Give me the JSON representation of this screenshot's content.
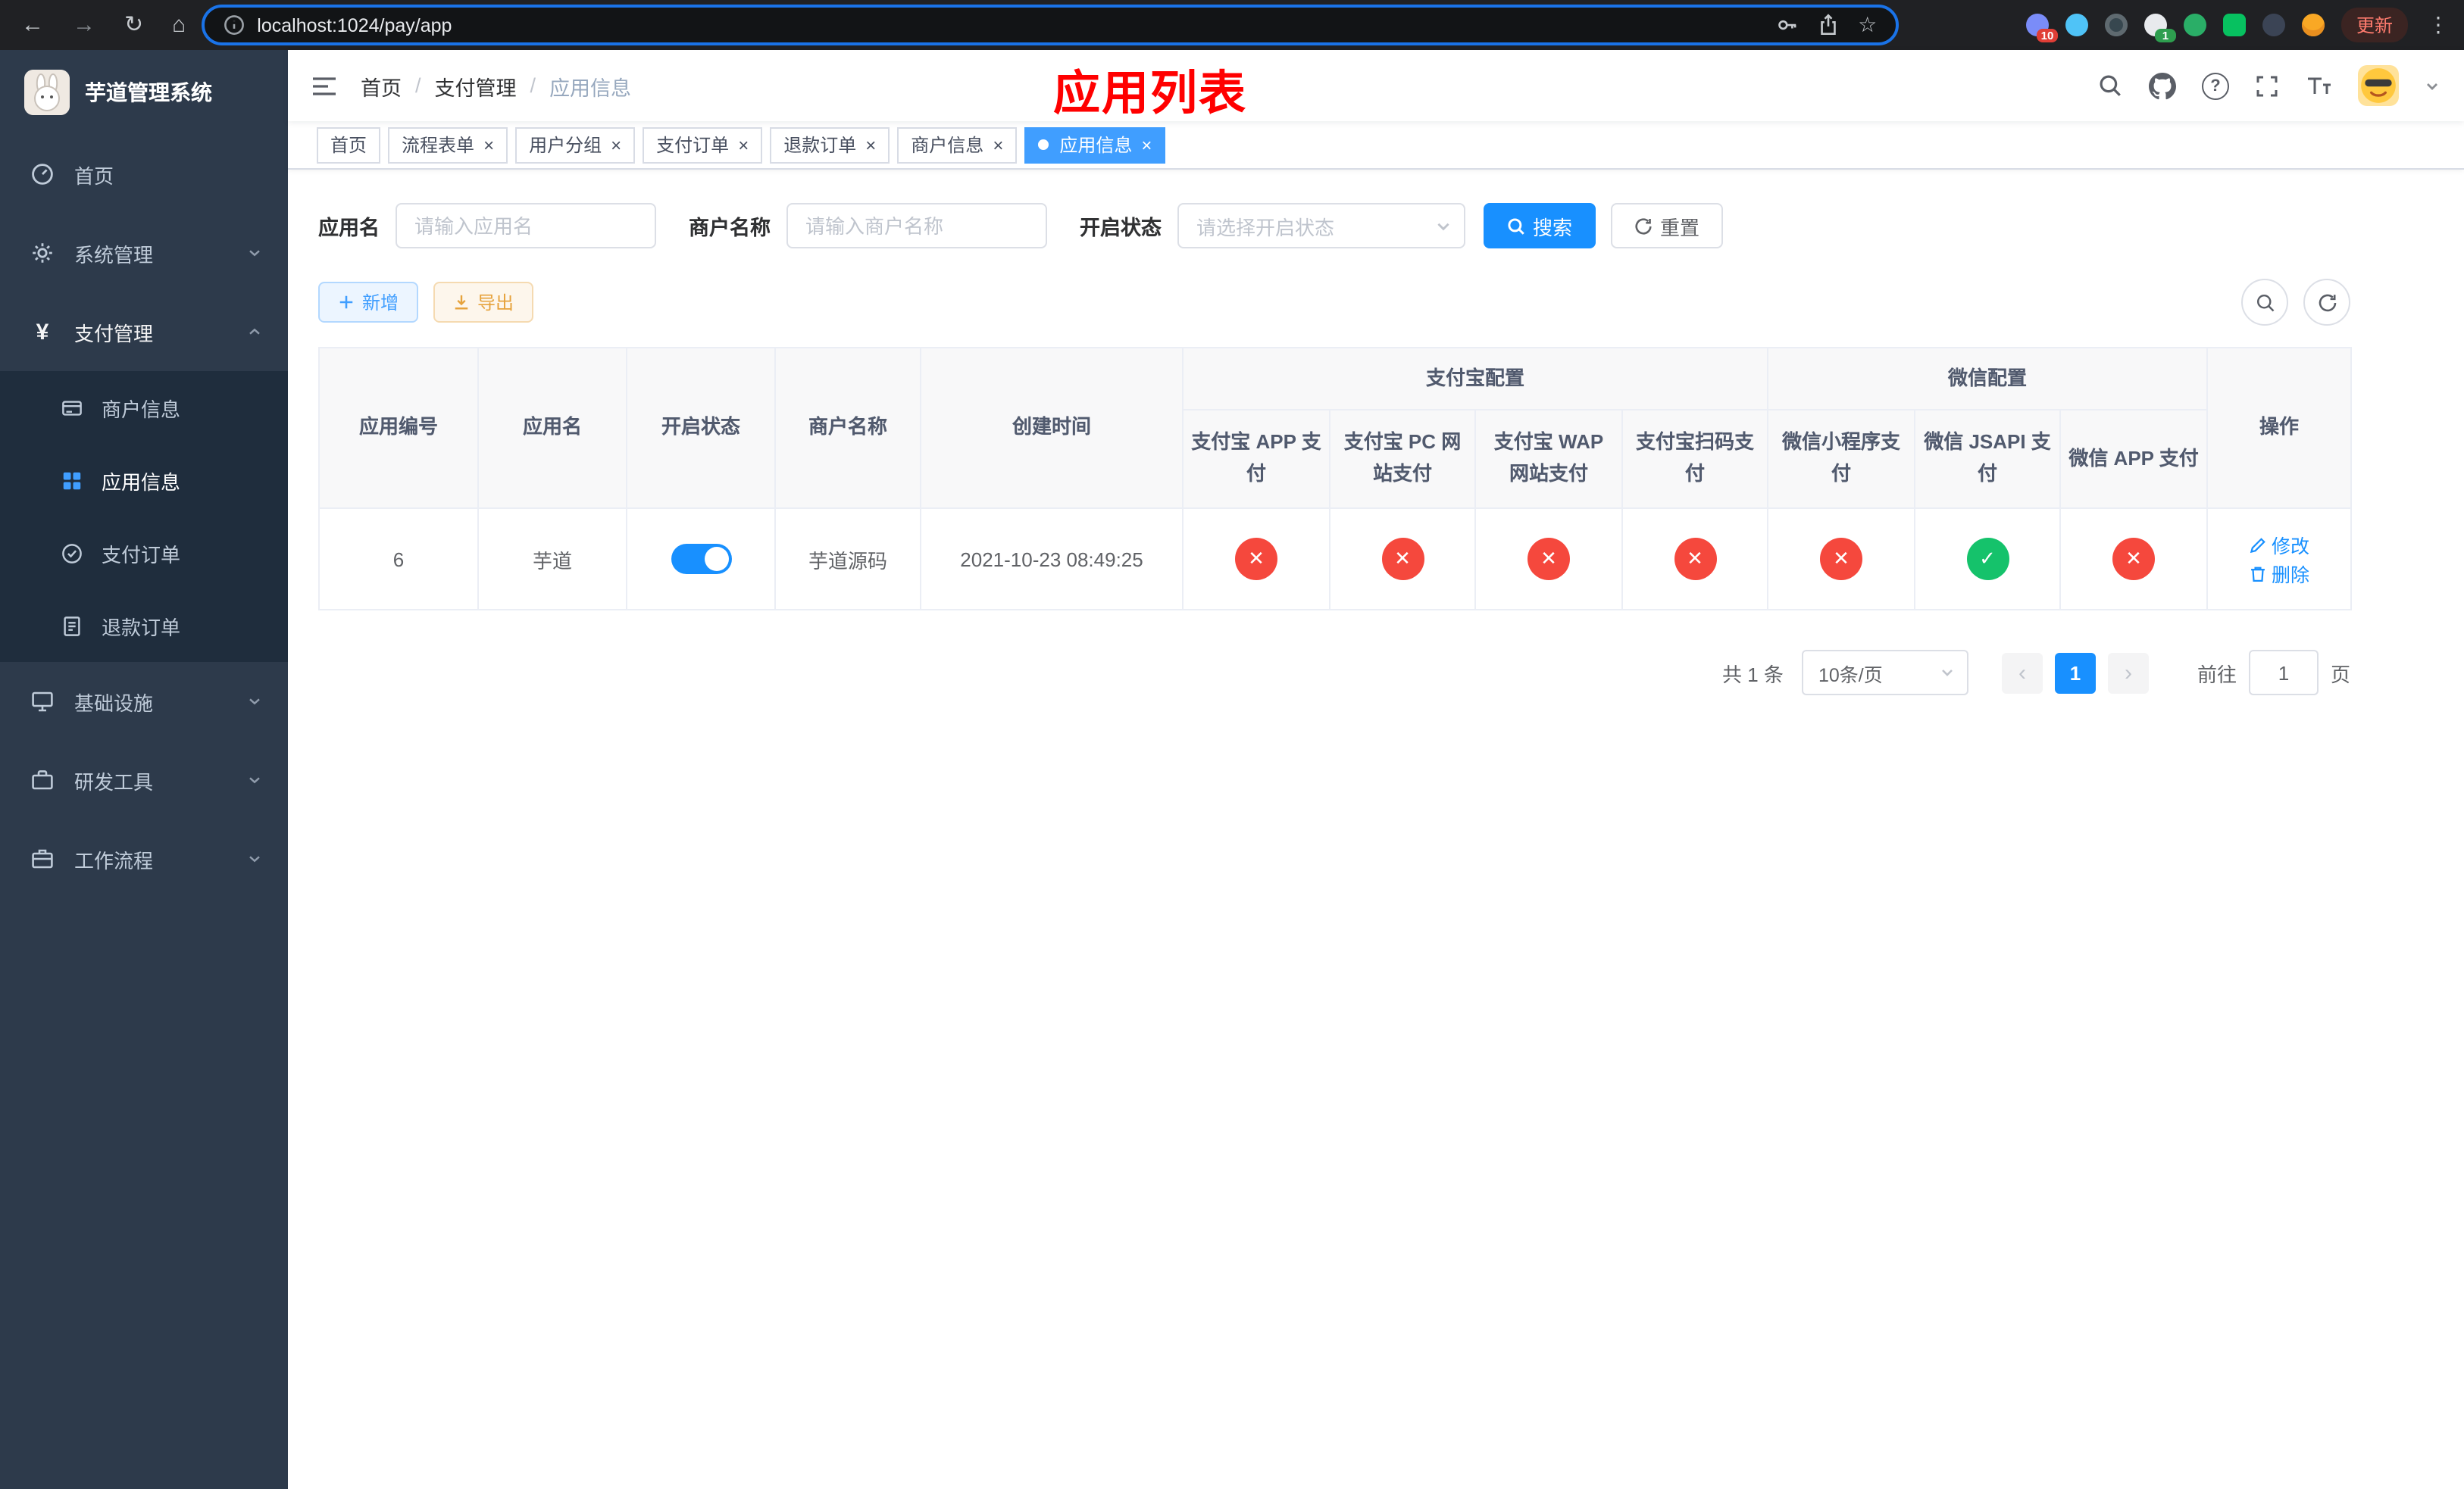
{
  "colors": {
    "primary_blue": "#1890ff",
    "tab_active_blue": "#409eff",
    "title_red": "#ff0000",
    "danger_red": "#f5483d",
    "success_green": "#15c26b",
    "sidebar_bg": "#2d3a4b",
    "warning_orange": "#e6a23c"
  },
  "browser": {
    "url": "localhost:1024/pay/app",
    "update_label": "更新",
    "ext_badge_grid": "10",
    "ext_badge_colorful": "1"
  },
  "sidebar": {
    "title": "芋道管理系统",
    "items": [
      {
        "label": "首页"
      },
      {
        "label": "系统管理"
      },
      {
        "label": "支付管理",
        "children": [
          {
            "label": "商户信息"
          },
          {
            "label": "应用信息",
            "active": true
          },
          {
            "label": "支付订单"
          },
          {
            "label": "退款订单"
          }
        ]
      },
      {
        "label": "基础设施"
      },
      {
        "label": "研发工具"
      },
      {
        "label": "工作流程"
      }
    ]
  },
  "header": {
    "breadcrumb": [
      "首页",
      "支付管理",
      "应用信息"
    ],
    "page_title": "应用列表"
  },
  "tabs": [
    {
      "label": "首页",
      "closable": false,
      "active": false
    },
    {
      "label": "流程表单",
      "closable": true,
      "active": false
    },
    {
      "label": "用户分组",
      "closable": true,
      "active": false
    },
    {
      "label": "支付订单",
      "closable": true,
      "active": false
    },
    {
      "label": "退款订单",
      "closable": true,
      "active": false
    },
    {
      "label": "商户信息",
      "closable": true,
      "active": false
    },
    {
      "label": "应用信息",
      "closable": true,
      "active": true
    }
  ],
  "filters": {
    "app_name_label": "应用名",
    "app_name_placeholder": "请输入应用名",
    "merchant_label": "商户名称",
    "merchant_placeholder": "请输入商户名称",
    "status_label": "开启状态",
    "status_placeholder": "请选择开启状态",
    "search_label": "搜索",
    "reset_label": "重置"
  },
  "toolbar": {
    "add_label": "新增",
    "export_label": "导出"
  },
  "table": {
    "groups": {
      "alipay": "支付宝配置",
      "wechat": "微信配置"
    },
    "columns": [
      "应用编号",
      "应用名",
      "开启状态",
      "商户名称",
      "创建时间",
      "支付宝 APP 支付",
      "支付宝 PC 网站支付",
      "支付宝 WAP 网站支付",
      "支付宝扫码支付",
      "微信小程序支付",
      "微信 JSAPI 支付",
      "微信 APP 支付",
      "操作"
    ],
    "rows": [
      {
        "id": "6",
        "app_name": "芋道",
        "enabled": "on",
        "merchant_name": "芋道源码",
        "created_at": "2021-10-23 08:49:25",
        "alipay_app": "disabled",
        "alipay_pc": "disabled",
        "alipay_wap": "disabled",
        "alipay_qr": "disabled",
        "wechat_mini": "disabled",
        "wechat_jsapi": "enabled",
        "wechat_app": "disabled",
        "edit_label": "修改",
        "delete_label": "删除"
      }
    ]
  },
  "pagination": {
    "total_text": "共 1 条",
    "page_size_text": "10条/页",
    "current_page": "1",
    "goto_label": "前往",
    "goto_value": "1",
    "page_unit": "页"
  }
}
